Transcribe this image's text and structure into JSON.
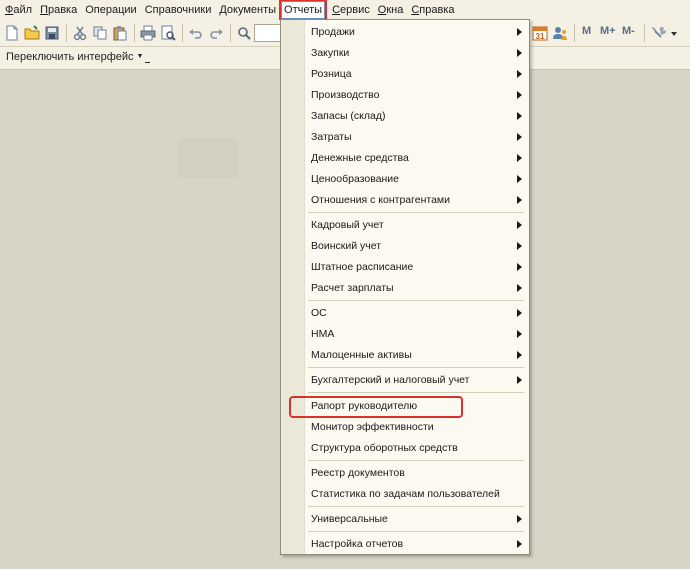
{
  "menubar": {
    "items": [
      {
        "label": "Файл",
        "accel": "Ф",
        "rest": "айл"
      },
      {
        "label": "Правка",
        "accel": "П",
        "rest": "равка"
      },
      {
        "label": "Операции"
      },
      {
        "label": "Справочники"
      },
      {
        "label": "Документы"
      },
      {
        "label": "Отчеты",
        "active": true
      },
      {
        "label": "Сервис",
        "accel": "С",
        "rest": "ервис"
      },
      {
        "label": "Окна",
        "accel": "О",
        "rest": "кна"
      },
      {
        "label": "Справка",
        "accel": "С",
        "rest": "правка"
      }
    ]
  },
  "toolbar": {
    "calendar_day": "31",
    "memory_buttons": [
      "M",
      "M+",
      "M-"
    ]
  },
  "interface_bar": {
    "switch_label": "Переключить интерфейс"
  },
  "dropdown": {
    "items": [
      {
        "label": "Продажи",
        "submenu": true
      },
      {
        "label": "Закупки",
        "submenu": true
      },
      {
        "label": "Розница",
        "submenu": true
      },
      {
        "label": "Производство",
        "submenu": true
      },
      {
        "label": "Запасы (склад)",
        "submenu": true
      },
      {
        "label": "Затраты",
        "submenu": true
      },
      {
        "label": "Денежные средства",
        "submenu": true
      },
      {
        "label": "Ценообразование",
        "submenu": true
      },
      {
        "label": "Отношения с контрагентами",
        "submenu": true
      },
      {
        "label": "Кадровый учет",
        "submenu": true
      },
      {
        "label": "Воинский учет",
        "submenu": true
      },
      {
        "label": "Штатное расписание",
        "submenu": true
      },
      {
        "label": "Расчет зарплаты",
        "submenu": true
      },
      {
        "label": "ОС",
        "submenu": true
      },
      {
        "label": "НМА",
        "submenu": true
      },
      {
        "label": "Малоценные активы",
        "submenu": true
      },
      {
        "label": "Бухгалтерский и налоговый учет",
        "submenu": true
      },
      {
        "label": "Рапорт руководителю",
        "submenu": false,
        "highlighted": true
      },
      {
        "label": "Монитор эффективности",
        "submenu": false
      },
      {
        "label": "Структура оборотных средств",
        "submenu": false
      },
      {
        "label": "Реестр документов",
        "submenu": false
      },
      {
        "label": "Статистика по задачам пользователей",
        "submenu": false
      },
      {
        "label": "Универсальные",
        "submenu": true
      },
      {
        "label": "Настройка отчетов",
        "submenu": true
      }
    ]
  },
  "colors": {
    "highlight": "#d9312b",
    "menu_bg": "#fbf9f0",
    "desktop_bg": "#d8d4c6"
  }
}
